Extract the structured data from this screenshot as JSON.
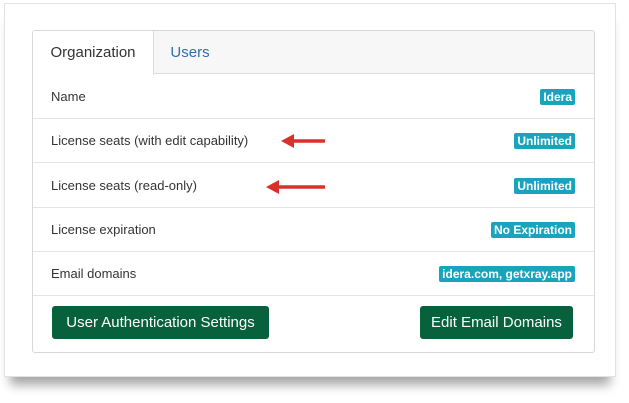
{
  "tabs": [
    {
      "label": "Organization"
    },
    {
      "label": "Users"
    }
  ],
  "rows": [
    {
      "label": "Name",
      "badge": "Idera"
    },
    {
      "label": "License seats (with edit capability)",
      "badge": "Unlimited"
    },
    {
      "label": "License seats (read-only)",
      "badge": "Unlimited"
    },
    {
      "label": "License expiration",
      "badge": "No Expiration"
    },
    {
      "label": "Email domains",
      "badge": "idera.com, getxray.app"
    }
  ],
  "buttons": {
    "auth_label": "User Authentication Settings",
    "email_label": "Edit Email Domains"
  },
  "colors": {
    "badge": "#1aa3bd",
    "button": "#06613c",
    "link": "#2f6cb5",
    "annotation_arrow": "#d9302c"
  }
}
